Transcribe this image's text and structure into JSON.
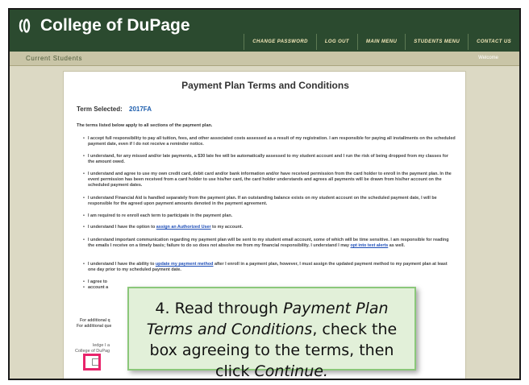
{
  "header": {
    "brand": "College of DuPage",
    "nav": [
      "Change Password",
      "Log Out",
      "Main Menu",
      "Students Menu",
      "Contact Us"
    ]
  },
  "subheader": {
    "title": "Current Students",
    "link": "Welcome"
  },
  "page": {
    "title": "Payment Plan Terms and Conditions",
    "term_label": "Term Selected:",
    "term_value": "2017FA",
    "intro": "The terms listed below apply to all sections of the payment plan.",
    "terms": [
      {
        "text": "I accept full responsibility to pay all tuition, fees, and other associated costs assessed as a result of my registration. I am responsible for paying all installments on the scheduled payment date, even if I do not receive a reminder notice."
      },
      {
        "text": "I understand, for any missed and/or late payments, a $30 late fee will be automatically assessed to my student account and I run the risk of being dropped from my classes for the amount owed."
      },
      {
        "text": "I understand and agree to use my own credit card, debit card and/or bank information and/or have received permission from the card holder to enroll in the payment plan. In the event permission has been received from a card holder to use his/her card, the card holder understands and agrees all payments will be drawn from his/her account on the scheduled payment dates."
      },
      {
        "text": "I understand Financial Aid is handled separately from the payment plan. If an outstanding balance exists on my student account on the scheduled payment date, I will be responsible for the agreed upon payment amounts denoted in the payment agreement."
      },
      {
        "text": "I am required to re enroll each term to participate in the payment plan."
      },
      {
        "pre": "I understand I have the option to ",
        "link": "assign an Authorized User",
        "post": " to my account."
      },
      {
        "pre": "I understand important communication regarding my payment plan will be sent to my student email account, some of which will be time sensitive. I am responsible for reading the emails I receive on a timely basis; failure to do so does not absolve me from my financial responsibility. I understand I may ",
        "link": "opt into text alerts",
        "post": " as well."
      },
      {
        "pre": "I understand I have the ability to ",
        "link": "update my payment method",
        "post": " after I enroll in a payment plan, however, I must assign the updated payment method to my payment plan at least one day prior to my scheduled payment date."
      },
      {
        "text": "I agree to"
      },
      {
        "text": "account a"
      }
    ],
    "footnote_1": "For additional q",
    "footnote_2": "For additional que",
    "ack_line1": "ledge I a",
    "ack_line2": "College of DuPag"
  },
  "callout": {
    "line1_pre": "4. Read through ",
    "line1_em": "Payment Plan Terms and Conditions",
    "line1_post": ", check the box agreeing to the terms, then click ",
    "line1_em2": "Continue.",
    "border_color": "#8bc77a",
    "bg_color": "#e2f0d9",
    "highlight_color": "#e8246b"
  }
}
